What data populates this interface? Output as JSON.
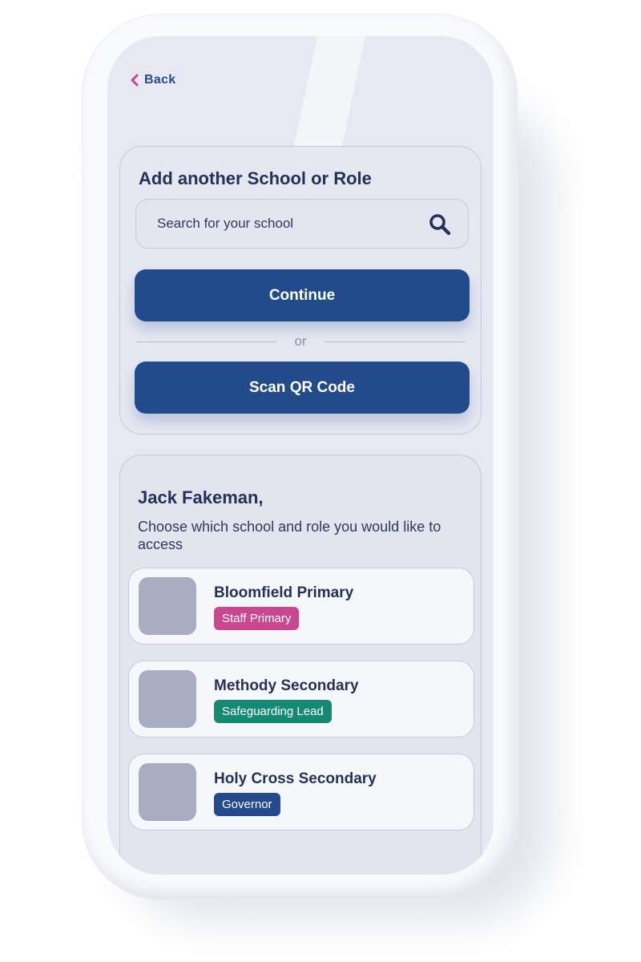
{
  "header": {
    "back_label": "Back"
  },
  "add_card": {
    "title": "Add another School or Role",
    "search_placeholder": "Search for your school",
    "continue_label": "Continue",
    "divider_text": "or",
    "scan_label": "Scan QR Code"
  },
  "list_card": {
    "greeting": "Jack Fakeman,",
    "subtitle": "Choose which school and role you would like to access",
    "schools": [
      {
        "name": "Bloomfield Primary",
        "role": "Staff Primary",
        "role_color": "#c8478f"
      },
      {
        "name": "Methody Secondary",
        "role": "Safeguarding Lead",
        "role_color": "#148a72"
      },
      {
        "name": "Holy Cross Secondary",
        "role": "Governor",
        "role_color": "#234a8c"
      }
    ]
  },
  "colors": {
    "accent": "#214b8b",
    "back_chevron": "#c8478f",
    "text_dark": "#243258"
  },
  "icons": {
    "back": "chevron-left-icon",
    "search": "search-icon"
  }
}
